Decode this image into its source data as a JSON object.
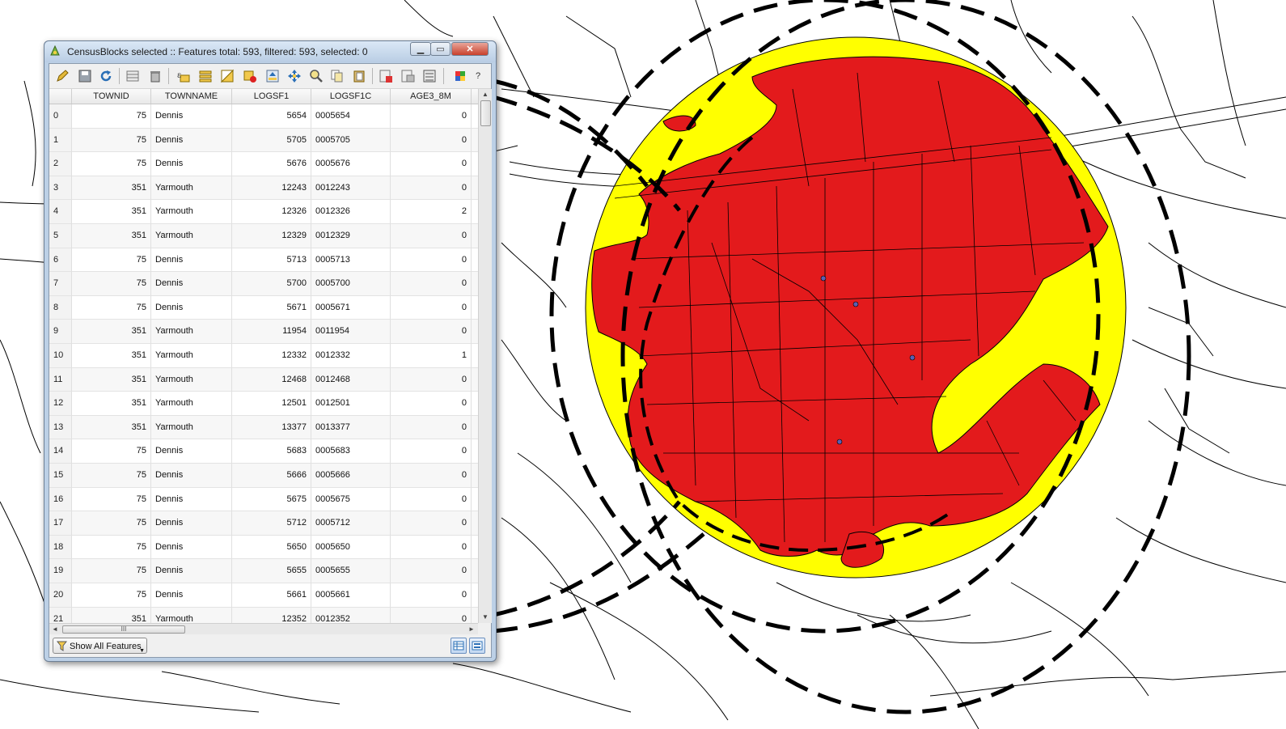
{
  "window": {
    "title": "CensusBlocks selected :: Features total: 593, filtered: 593, selected: 0"
  },
  "toolbar": {
    "icons": [
      "pencil-icon",
      "save-icon",
      "reload-icon",
      "delete-feature-icon",
      "trash-icon",
      "expression-select-icon",
      "select-all-icon",
      "invert-selection-icon",
      "deselect-icon",
      "move-selection-top-icon",
      "pan-to-selection-icon",
      "zoom-to-selection-icon",
      "copy-icon",
      "paste-icon",
      "new-field-icon",
      "delete-field-icon",
      "field-calculator-icon",
      "conditional-format-icon",
      "help-icon"
    ],
    "help_label": "?"
  },
  "table": {
    "columns": [
      "TOWNID",
      "TOWNNAME",
      "LOGSF1",
      "LOGSF1C",
      "AGE3_8M"
    ],
    "rows": [
      {
        "n": "0",
        "townid": "75",
        "townname": "Dennis",
        "logsf1": "5654",
        "logsf1c": "0005654",
        "age": "0"
      },
      {
        "n": "1",
        "townid": "75",
        "townname": "Dennis",
        "logsf1": "5705",
        "logsf1c": "0005705",
        "age": "0"
      },
      {
        "n": "2",
        "townid": "75",
        "townname": "Dennis",
        "logsf1": "5676",
        "logsf1c": "0005676",
        "age": "0"
      },
      {
        "n": "3",
        "townid": "351",
        "townname": "Yarmouth",
        "logsf1": "12243",
        "logsf1c": "0012243",
        "age": "0"
      },
      {
        "n": "4",
        "townid": "351",
        "townname": "Yarmouth",
        "logsf1": "12326",
        "logsf1c": "0012326",
        "age": "2"
      },
      {
        "n": "5",
        "townid": "351",
        "townname": "Yarmouth",
        "logsf1": "12329",
        "logsf1c": "0012329",
        "age": "0"
      },
      {
        "n": "6",
        "townid": "75",
        "townname": "Dennis",
        "logsf1": "5713",
        "logsf1c": "0005713",
        "age": "0"
      },
      {
        "n": "7",
        "townid": "75",
        "townname": "Dennis",
        "logsf1": "5700",
        "logsf1c": "0005700",
        "age": "0"
      },
      {
        "n": "8",
        "townid": "75",
        "townname": "Dennis",
        "logsf1": "5671",
        "logsf1c": "0005671",
        "age": "0"
      },
      {
        "n": "9",
        "townid": "351",
        "townname": "Yarmouth",
        "logsf1": "11954",
        "logsf1c": "0011954",
        "age": "0"
      },
      {
        "n": "10",
        "townid": "351",
        "townname": "Yarmouth",
        "logsf1": "12332",
        "logsf1c": "0012332",
        "age": "1"
      },
      {
        "n": "11",
        "townid": "351",
        "townname": "Yarmouth",
        "logsf1": "12468",
        "logsf1c": "0012468",
        "age": "0"
      },
      {
        "n": "12",
        "townid": "351",
        "townname": "Yarmouth",
        "logsf1": "12501",
        "logsf1c": "0012501",
        "age": "0"
      },
      {
        "n": "13",
        "townid": "351",
        "townname": "Yarmouth",
        "logsf1": "13377",
        "logsf1c": "0013377",
        "age": "0"
      },
      {
        "n": "14",
        "townid": "75",
        "townname": "Dennis",
        "logsf1": "5683",
        "logsf1c": "0005683",
        "age": "0"
      },
      {
        "n": "15",
        "townid": "75",
        "townname": "Dennis",
        "logsf1": "5666",
        "logsf1c": "0005666",
        "age": "0"
      },
      {
        "n": "16",
        "townid": "75",
        "townname": "Dennis",
        "logsf1": "5675",
        "logsf1c": "0005675",
        "age": "0"
      },
      {
        "n": "17",
        "townid": "75",
        "townname": "Dennis",
        "logsf1": "5712",
        "logsf1c": "0005712",
        "age": "0"
      },
      {
        "n": "18",
        "townid": "75",
        "townname": "Dennis",
        "logsf1": "5650",
        "logsf1c": "0005650",
        "age": "0"
      },
      {
        "n": "19",
        "townid": "75",
        "townname": "Dennis",
        "logsf1": "5655",
        "logsf1c": "0005655",
        "age": "0"
      },
      {
        "n": "20",
        "townid": "75",
        "townname": "Dennis",
        "logsf1": "5661",
        "logsf1c": "0005661",
        "age": "0"
      },
      {
        "n": "21",
        "townid": "351",
        "townname": "Yarmouth",
        "logsf1": "12352",
        "logsf1c": "0012352",
        "age": "0"
      }
    ]
  },
  "scrollbar": {
    "thumb_grip": "III"
  },
  "bottom": {
    "show_all_label": "Show All Features",
    "view_icons": [
      "table-view-icon",
      "form-view-icon"
    ]
  },
  "map": {
    "colors": {
      "buffer_outer": "#ffff00",
      "selection": "#e31a1c",
      "streets": "#000000",
      "dashed_rings": "#000000"
    }
  }
}
